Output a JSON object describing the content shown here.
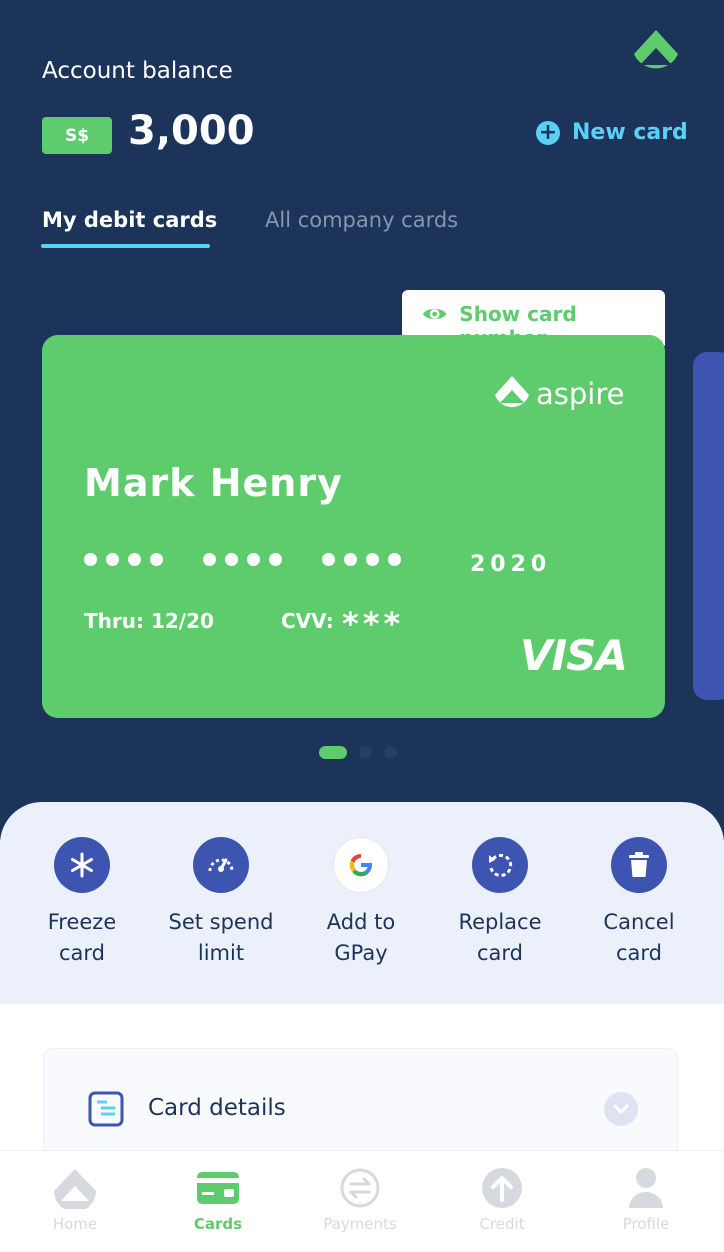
{
  "balance": {
    "label": "Account balance",
    "currency": "S$",
    "amount": "3,000"
  },
  "new_card": {
    "label": "New card",
    "icon": "plus-circle-icon"
  },
  "tabs": [
    {
      "label": "My debit cards",
      "active": true
    },
    {
      "label": "All company cards",
      "active": false
    }
  ],
  "show_card_number": {
    "label": "Show card number",
    "icon": "eye-icon"
  },
  "card": {
    "brand": "aspire",
    "holder": "Mark Henry",
    "last_digits": "2020",
    "thru": "Thru: 12/20",
    "cvv_label": "CVV:",
    "cvv_value": "***",
    "network": "VISA"
  },
  "actions": [
    {
      "line1": "Freeze",
      "line2": "card",
      "icon": "snowflake-icon"
    },
    {
      "line1": "Set spend",
      "line2": "limit",
      "icon": "speedometer-icon"
    },
    {
      "line1": "Add to",
      "line2": "GPay",
      "icon": "google-icon"
    },
    {
      "line1": "Replace",
      "line2": "card",
      "icon": "refresh-icon"
    },
    {
      "line1": "Cancel",
      "line2": "card",
      "icon": "trash-icon"
    }
  ],
  "details": {
    "title": "Card details",
    "icon": "document-icon"
  },
  "nav": [
    {
      "label": "Home",
      "icon": "home-icon"
    },
    {
      "label": "Cards",
      "icon": "card-icon",
      "active": true
    },
    {
      "label": "Payments",
      "icon": "transfer-icon"
    },
    {
      "label": "Credit",
      "icon": "arrow-up-icon"
    },
    {
      "label": "Profile",
      "icon": "user-icon"
    }
  ],
  "colors": {
    "navy": "#1c3459",
    "green": "#5ecb6c",
    "cyan": "#5ad0f5",
    "indigo": "#3d54b0"
  }
}
